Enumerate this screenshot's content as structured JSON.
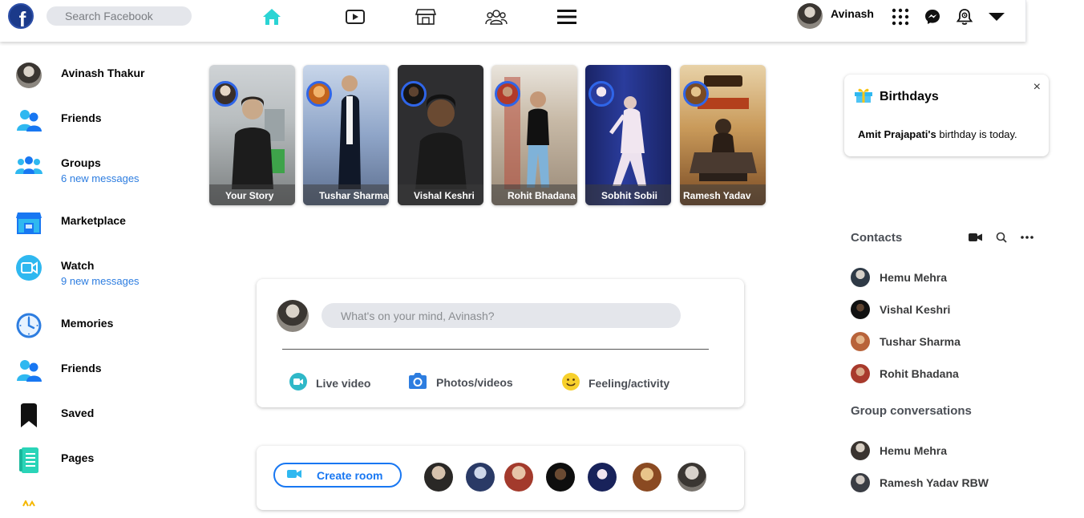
{
  "header": {
    "logo_letter": "f",
    "search_placeholder": "Search Facebook",
    "nav_icons": [
      "home-icon",
      "watch-icon",
      "marketplace-icon",
      "groups-icon",
      "menu-icon"
    ],
    "user_name": "Avinash",
    "right_icons": [
      "apps-grid-icon",
      "messenger-icon",
      "notifications-icon",
      "account-dropdown-icon"
    ],
    "accent": "#1877f2"
  },
  "sidebar": {
    "items": [
      {
        "label": "Avinash Thakur",
        "icon": "profile-avatar"
      },
      {
        "label": "Friends",
        "icon": "friends-icon"
      },
      {
        "label": "Groups",
        "sub": "6 new messages",
        "icon": "groups-icon"
      },
      {
        "label": "Marketplace",
        "icon": "marketplace-icon"
      },
      {
        "label": "Watch",
        "sub": "9 new messages",
        "icon": "watch-icon"
      },
      {
        "label": "Memories",
        "icon": "memories-clock-icon"
      },
      {
        "label": "Friends",
        "icon": "friends-icon"
      },
      {
        "label": "Saved",
        "icon": "saved-bookmark-icon"
      },
      {
        "label": "Pages",
        "icon": "pages-icon"
      }
    ]
  },
  "stories": [
    {
      "name": "Your Story"
    },
    {
      "name": "Tushar Sharma"
    },
    {
      "name": "Vishal Keshri"
    },
    {
      "name": "Rohit Bhadana"
    },
    {
      "name": "Sobhit Sobii"
    },
    {
      "name": "Ramesh Yadav"
    }
  ],
  "composer": {
    "placeholder": "What's on your mind, Avinash?",
    "actions": [
      {
        "label": "Live video",
        "icon": "live-video-icon"
      },
      {
        "label": "Photos/videos",
        "icon": "camera-icon"
      },
      {
        "label": "Feeling/activity",
        "icon": "smiley-icon"
      }
    ]
  },
  "rooms": {
    "create_label": "Create room"
  },
  "birthdays": {
    "title": "Birthdays",
    "close": "×",
    "person": "Amit Prajapati's",
    "text": " birthday is today."
  },
  "contacts": {
    "title": "Contacts",
    "icons": [
      "video-call-icon",
      "search-icon",
      "more-options-icon"
    ],
    "people": [
      "Hemu Mehra",
      "Vishal Keshri",
      "Tushar Sharma",
      "Rohit Bhadana"
    ]
  },
  "group_conversations": {
    "title": "Group conversations",
    "people": [
      "Hemu Mehra",
      "Ramesh Yadav RBW"
    ]
  }
}
